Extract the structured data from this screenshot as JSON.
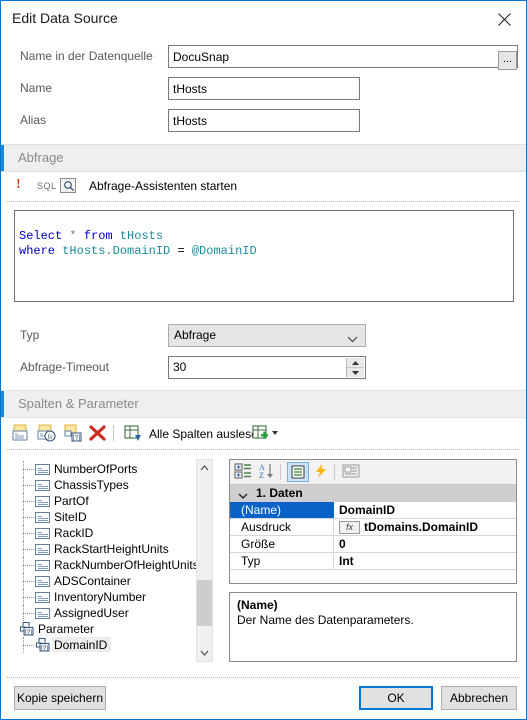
{
  "window": {
    "title": "Edit Data Source",
    "close_icon": "close-icon"
  },
  "form": {
    "name_source_label": "Name in der Datenquelle",
    "name_source_value": "DocuSnap",
    "ellipsis_label": "...",
    "name_label": "Name",
    "name_value": "tHosts",
    "alias_label": "Alias",
    "alias_value": "tHosts"
  },
  "query_section": {
    "header": "Abfrage",
    "warning_icon": "!",
    "sql_icon_label": "SQL",
    "magnifier_icon": "magnifier-icon",
    "wizard_link": "Abfrage-Assistenten starten",
    "sql": {
      "line1": {
        "kw1": "Select",
        "star": "*",
        "kw2": "from",
        "table": "tHosts"
      },
      "line2": {
        "kw1": "where",
        "column": "tHosts.DomainID",
        "op": "=",
        "param": "@DomainID"
      }
    },
    "type_label": "Typ",
    "type_value": "Abfrage",
    "timeout_label": "Abfrage-Timeout",
    "timeout_value": "30"
  },
  "columns_section": {
    "header": "Spalten & Parameter",
    "toolbar": {
      "add_column": "add-column-icon",
      "add_calculated_column": "add-calculated-column-icon",
      "add_parameter": "add-parameter-icon",
      "delete": "delete-icon",
      "read_all_columns_icon": "table-read-icon",
      "read_all_columns": "Alle Spalten auslesen",
      "more_icon": "table-add-dropdown-icon"
    },
    "tree": {
      "items": [
        {
          "label": "NumberOfPorts",
          "type": "column",
          "level": 2,
          "selected": false
        },
        {
          "label": "ChassisTypes",
          "type": "column",
          "level": 2,
          "selected": false
        },
        {
          "label": "PartOf",
          "type": "column",
          "level": 2,
          "selected": false
        },
        {
          "label": "SiteID",
          "type": "column",
          "level": 2,
          "selected": false
        },
        {
          "label": "RackID",
          "type": "column",
          "level": 2,
          "selected": false
        },
        {
          "label": "RackStartHeightUnits",
          "type": "column",
          "level": 2,
          "selected": false
        },
        {
          "label": "RackNumberOfHeightUnits",
          "type": "column",
          "level": 2,
          "selected": false
        },
        {
          "label": "ADSContainer",
          "type": "column",
          "level": 2,
          "selected": false
        },
        {
          "label": "InventoryNumber",
          "type": "column",
          "level": 2,
          "selected": false
        },
        {
          "label": "AssignedUser",
          "type": "column",
          "level": 2,
          "selected": false
        },
        {
          "label": "Parameter",
          "type": "parameter-group",
          "level": 1,
          "selected": false
        },
        {
          "label": "DomainID",
          "type": "parameter",
          "level": 2,
          "selected": true
        }
      ],
      "scroll_up_icon": "chevron-up-icon",
      "scroll_down_icon": "chevron-down-icon"
    },
    "property_grid": {
      "toolbar": {
        "categorized_icon": "categorized-view-icon",
        "alphabetical_icon": "sort-alphabetical-icon",
        "properties_icon": "properties-icon",
        "events_icon": "events-lightning-icon",
        "pages_icon": "property-pages-icon"
      },
      "category": "1. Daten",
      "category_chevron": "chevron-down-icon",
      "rows": [
        {
          "name": "(Name)",
          "value": "DomainID",
          "selected": true,
          "has_fx": false
        },
        {
          "name": "Ausdruck",
          "value": "tDomains.DomainID",
          "selected": false,
          "has_fx": true,
          "fx_label": "fx"
        },
        {
          "name": "Größe",
          "value": "0",
          "selected": false,
          "has_fx": false
        },
        {
          "name": "Typ",
          "value": "Int",
          "selected": false,
          "has_fx": false
        }
      ],
      "description": {
        "title": "(Name)",
        "text": "Der Name des Datenparameters."
      }
    }
  },
  "footer": {
    "save_copy": "Kopie speichern",
    "ok": "OK",
    "cancel": "Abbrechen"
  },
  "colors": {
    "accent": "#0078d7",
    "section_accent": "#1b8ad4",
    "selection": "#0a64c8",
    "keyword": "#0000c8",
    "identifier": "#1a8a9b",
    "warning": "#d9430f"
  }
}
